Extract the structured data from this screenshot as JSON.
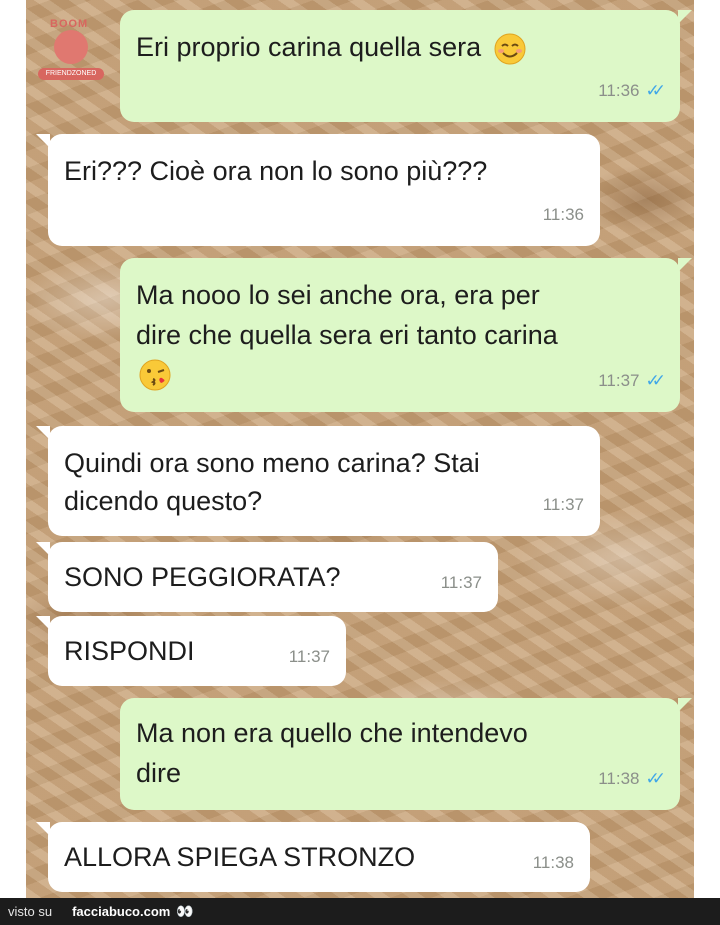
{
  "logo": {
    "top": "BOOM",
    "bottom": "FRIENDZONED"
  },
  "messages": [
    {
      "text": "Eri proprio carina quella sera",
      "emoji": "relaxed-smile",
      "time": "11:36",
      "ticks": "✓✓"
    },
    {
      "text": "Eri??? Cioè ora non lo sono più???",
      "time": "11:36"
    },
    {
      "line1": "Ma nooo lo sei anche ora, era per",
      "line2": "dire che quella sera eri tanto carina",
      "emoji": "kiss-face",
      "time": "11:37",
      "ticks": "✓✓"
    },
    {
      "line1": "Quindi ora sono meno carina? Stai",
      "line2": "dicendo questo?",
      "time": "11:37"
    },
    {
      "text": "SONO PEGGIORATA?",
      "time": "11:37"
    },
    {
      "text": "RISPONDI",
      "time": "11:37"
    },
    {
      "line1": "Ma non era quello che intendevo",
      "line2": "dire",
      "time": "11:38",
      "ticks": "✓✓"
    },
    {
      "text": "ALLORA SPIEGA STRONZO",
      "time": "11:38"
    }
  ],
  "footer": {
    "prefix": "visto su",
    "site": "facciabuco.com",
    "eyes": "👀"
  },
  "colors": {
    "incoming": "#ffffff",
    "outgoing": "#ddf8c8",
    "read_ticks": "#41a7e8",
    "wallpaper": "#c9a47a"
  }
}
